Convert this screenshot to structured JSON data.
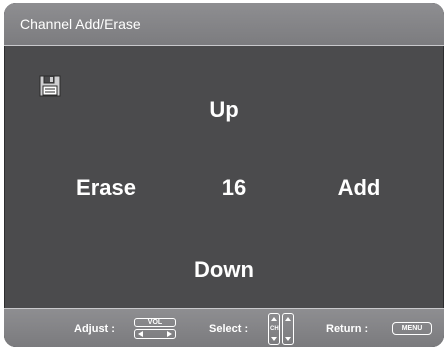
{
  "title": "Channel Add/Erase",
  "icons": {
    "save": "floppy-disk-icon",
    "vol": "vol-left-right-icon",
    "ch": "ch-up-down-icon",
    "menu": "menu-key-icon"
  },
  "controls": {
    "up": "Up",
    "down": "Down",
    "erase": "Erase",
    "add": "Add",
    "channel": "16"
  },
  "footer": {
    "adjust_label": "Adjust :",
    "vol_label": "VOL",
    "select_label": "Select :",
    "ch_label": "CH",
    "return_label": "Return :",
    "menu_label": "MENU"
  },
  "colors": {
    "panel": "#4b4b4d",
    "bar": "#86868a",
    "text": "#ffffff"
  }
}
